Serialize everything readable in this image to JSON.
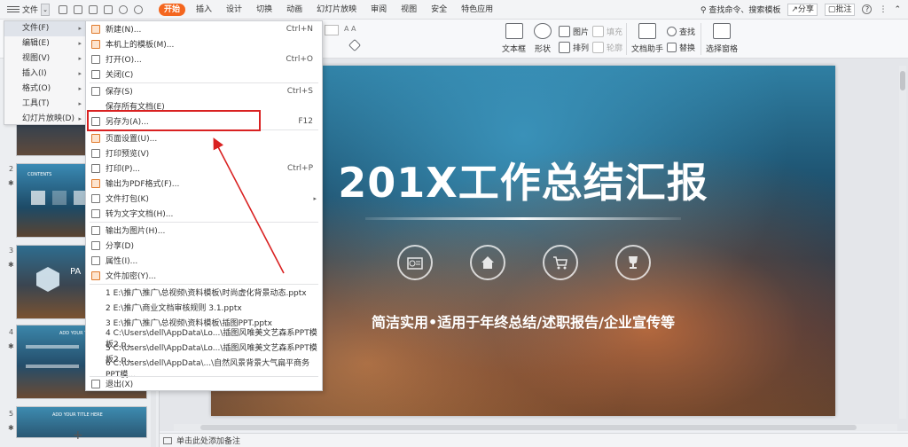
{
  "topbar": {
    "file_label": "文件",
    "tabs": [
      "开始",
      "插入",
      "设计",
      "切换",
      "动画",
      "幻灯片放映",
      "审阅",
      "视图",
      "安全",
      "特色应用"
    ],
    "active_tab": "开始",
    "search": "查找命令、搜索模板",
    "share": "分享",
    "comment": "批注",
    "help": "?"
  },
  "ribbon": {
    "textbox": "文本框",
    "shape": "形状",
    "picture": "图片",
    "arrange": "排列",
    "fill": "填充",
    "outline": "轮廓",
    "doc_helper": "文档助手",
    "find": "查找",
    "replace": "替换",
    "select_pane": "选择窗格"
  },
  "left_menu": [
    {
      "label": "文件(F)",
      "selected": true
    },
    {
      "label": "编辑(E)",
      "selected": false
    },
    {
      "label": "视图(V)",
      "selected": false
    },
    {
      "label": "插入(I)",
      "selected": false
    },
    {
      "label": "格式(O)",
      "selected": false
    },
    {
      "label": "工具(T)",
      "selected": false
    },
    {
      "label": "幻灯片放映(D)",
      "selected": false
    }
  ],
  "file_menu": {
    "new": {
      "label": "新建(N)...",
      "shortcut": "Ctrl+N"
    },
    "template": {
      "label": "本机上的模板(M)..."
    },
    "open": {
      "label": "打开(O)...",
      "shortcut": "Ctrl+O"
    },
    "close": {
      "label": "关闭(C)"
    },
    "save": {
      "label": "保存(S)",
      "shortcut": "Ctrl+S"
    },
    "save_all": {
      "label": "保存所有文档(E)"
    },
    "save_as": {
      "label": "另存为(A)...",
      "shortcut": "F12"
    },
    "page_setup": {
      "label": "页面设置(U)..."
    },
    "print_preview": {
      "label": "打印预览(V)"
    },
    "print": {
      "label": "打印(P)...",
      "shortcut": "Ctrl+P"
    },
    "export_pdf": {
      "label": "输出为PDF格式(F)..."
    },
    "package": {
      "label": "文件打包(K)"
    },
    "to_text": {
      "label": "转为文字文档(H)..."
    },
    "export_image": {
      "label": "输出为图片(H)..."
    },
    "share": {
      "label": "分享(D)"
    },
    "properties": {
      "label": "属性(I)..."
    },
    "encrypt": {
      "label": "文件加密(Y)..."
    },
    "recent": [
      "1 E:\\推广\\推广\\总视频\\资料模板\\时尚虚化背景动态.pptx",
      "2 E:\\推广\\商业文档审核规则 3.1.pptx",
      "3 E:\\推广\\推广\\总视频\\资料模板\\插图PPT.pptx",
      "4 C:\\Users\\dell\\AppData\\Lo...\\插图风唯美文艺森系PPT模板2.p...",
      "5 C:\\Users\\dell\\AppData\\Lo...\\插图风唯美文艺森系PPT模板2.p...",
      "6 C:\\Users\\dell\\AppData\\...\\自然风景背景大气扁平商务PPT模..."
    ],
    "exit": {
      "label": "退出(X)"
    }
  },
  "slide_panel": {
    "numbers": [
      "2",
      "3",
      "4",
      "5"
    ],
    "thumb_texts": [
      "CONTENTS",
      "PA",
      "ADD YOUR TITLE",
      "ADD YOUR TITLE HERE"
    ],
    "add": "+"
  },
  "slide": {
    "title": "201X工作总结汇报",
    "subtitle": "简洁实用•适用于年终总结/述职报告/企业宣传等"
  },
  "notes": {
    "placeholder": "单击此处添加备注"
  },
  "colors": {
    "accent": "#f4661f",
    "highlight_red": "#d92121"
  }
}
